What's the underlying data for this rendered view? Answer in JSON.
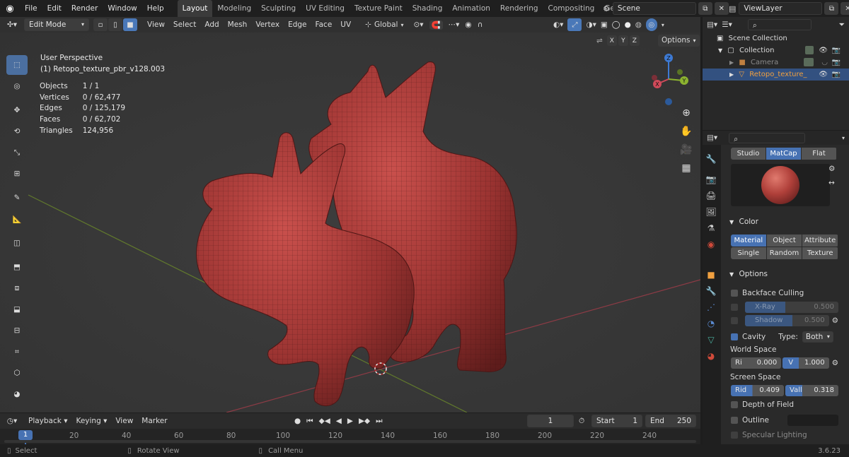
{
  "app": {
    "menus": [
      "File",
      "Edit",
      "Render",
      "Window",
      "Help"
    ],
    "workspaces": [
      {
        "label": "Layout",
        "active": true
      },
      {
        "label": "Modeling"
      },
      {
        "label": "Sculpting"
      },
      {
        "label": "UV Editing"
      },
      {
        "label": "Texture Paint"
      },
      {
        "label": "Shading"
      },
      {
        "label": "Animation"
      },
      {
        "label": "Rendering"
      },
      {
        "label": "Compositing"
      },
      {
        "label": "Geometry Noc"
      }
    ],
    "scene_label": "Scene",
    "viewlayer_label": "ViewLayer",
    "version": "3.6.23"
  },
  "viewport_header": {
    "mode": "Edit Mode",
    "menus": [
      "View",
      "Select",
      "Add",
      "Mesh",
      "Vertex",
      "Edge",
      "Face",
      "UV"
    ],
    "orientation": "Global",
    "axis_labels": [
      "X",
      "Y",
      "Z"
    ],
    "options_label": "Options"
  },
  "viewport": {
    "perspective": "User Perspective",
    "object_name": "(1) Retopo_texture_pbr_v128.003",
    "stats": [
      {
        "label": "Objects",
        "value": "1 / 1"
      },
      {
        "label": "Vertices",
        "value": "0 / 62,477"
      },
      {
        "label": "Edges",
        "value": "0 / 125,179"
      },
      {
        "label": "Faces",
        "value": "0 / 62,702"
      },
      {
        "label": "Triangles",
        "value": "124,956"
      }
    ],
    "gizmo_labels": {
      "z": "Z",
      "y": "Y",
      "x": "X"
    }
  },
  "timeline": {
    "menus": [
      "Playback",
      "Keying",
      "View",
      "Marker"
    ],
    "current_frame": "1",
    "start_label": "Start",
    "start_value": "1",
    "end_label": "End",
    "end_value": "250",
    "ruler_ticks": [
      "1",
      "20",
      "40",
      "60",
      "80",
      "100",
      "120",
      "140",
      "160",
      "180",
      "200",
      "220",
      "240"
    ]
  },
  "statusbar": {
    "items": [
      "Select",
      "Rotate View",
      "Call Menu"
    ]
  },
  "outliner": {
    "rows": [
      {
        "label": "Scene Collection"
      },
      {
        "label": "Collection"
      },
      {
        "label": "Camera"
      },
      {
        "label": "Retopo_texture_"
      }
    ]
  },
  "properties": {
    "lighting_modes": [
      "Studio",
      "MatCap",
      "Flat"
    ],
    "color_panel": "Color",
    "color_modes": [
      "Material",
      "Object",
      "Attribute",
      "Single",
      "Random",
      "Texture"
    ],
    "options_panel": "Options",
    "backface": "Backface Culling",
    "xray_label": "X-Ray",
    "xray_value": "0.500",
    "shadow_label": "Shadow",
    "shadow_value": "0.500",
    "cavity": "Cavity",
    "type_label": "Type:",
    "type_value": "Both",
    "world_space": "World Space",
    "ridge_short": "Ri",
    "ridge_value": "0.000",
    "valley_short": "V",
    "valley_value": "1.000",
    "screen_space": "Screen Space",
    "screen_ridge_label": "Rid",
    "screen_ridge_value": "0.409",
    "screen_valley_label": "Vall",
    "screen_valley_value": "0.318",
    "dof": "Depth of Field",
    "outline": "Outline",
    "specular": "Specular Lighting"
  }
}
